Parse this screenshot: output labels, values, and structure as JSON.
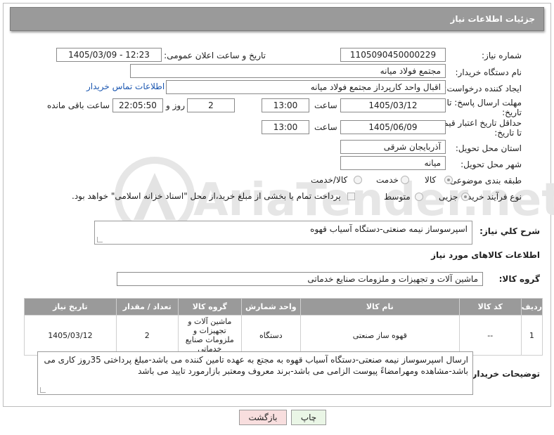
{
  "header": {
    "title": "جزئیات اطلاعات نیاز"
  },
  "need_number": {
    "label": "شماره نیاز:",
    "value": "1105090450000229"
  },
  "announce": {
    "label": "تاریخ و ساعت اعلان عمومی:",
    "value": "1405/03/09 - 12:23"
  },
  "buyer": {
    "label": "نام دستگاه خریدار:",
    "value": "مجتمع فولاد میانه"
  },
  "creator": {
    "label": "ایجاد کننده درخواست:",
    "value": "اقبال واحد کارپرداز مجتمع فولاد میانه",
    "contact_link": "اطلاعات تماس خریدار"
  },
  "deadline": {
    "label_line1": "مهلت ارسال پاسخ: تا",
    "label_line2": "تاریخ:",
    "date": "1405/03/12",
    "time_label": "ساعت",
    "time": "13:00",
    "days": "2",
    "days_label": "روز و",
    "remaining": "22:05:50",
    "remaining_label": "ساعت باقی مانده"
  },
  "price_validity": {
    "label_line1": "حداقل تاریخ اعتبار قیمت:",
    "label_line2": "تا تاریخ:",
    "date": "1405/06/09",
    "time_label": "ساعت",
    "time": "13:00"
  },
  "province": {
    "label": "استان محل تحویل:",
    "value": "آذربایجان شرقی"
  },
  "city": {
    "label": "شهر محل تحویل:",
    "value": "میانه"
  },
  "category": {
    "label": "طبقه بندی موضوعی:",
    "options": [
      "کالا",
      "خدمت",
      "کالا/خدمت"
    ],
    "selected": "کالا"
  },
  "process": {
    "label": "نوع فرآیند خرید :",
    "options": [
      "جزیی",
      "متوسط"
    ],
    "selected": "جزیی",
    "payment_note": "پرداخت تمام یا بخشی از مبلغ خرید،از محل \"اسناد خزانه اسلامی\" خواهد بود."
  },
  "description": {
    "label": "شرح کلي نياز:",
    "value": "اسپرسوساز نیمه صنعتی-دستگاه آسیاب قهوه"
  },
  "goods_info_title": "اطلاعات کالاهای مورد نیاز",
  "goods_group": {
    "label": "گروه کالا:",
    "value": "ماشین آلات و تجهیزات و ملزومات صنایع خدماتی"
  },
  "table": {
    "headers": [
      "ردیف",
      "کد کالا",
      "نام کالا",
      "واحد شمارش",
      "گروه کالا",
      "تعداد / مقدار",
      "تاریخ نیاز"
    ],
    "rows": [
      {
        "index": "1",
        "code": "--",
        "name": "قهوه ساز صنعتی",
        "unit": "دستگاه",
        "group": "ماشین آلات و تجهیزات و ملزومات صنایع خدماتی",
        "qty": "2",
        "date": "1405/03/12"
      }
    ]
  },
  "buyer_notes": {
    "label": "توضیحات خریدار:",
    "value": "ارسال اسپرسوساز نیمه صنعتی-دستگاه آسیاب قهوه به مجتع به عهده تامین کننده می باشد-مبلغ پرداختی 35روز کاری می باشد-مشاهده ومهرامضاءً پیوست الزامی می باشد-برند معروف ومعتبر بازارمورد تایید می باشد"
  },
  "buttons": {
    "print": "چاپ",
    "back": "بازگشت"
  },
  "watermark": {
    "text": "AriaTender.net"
  }
}
